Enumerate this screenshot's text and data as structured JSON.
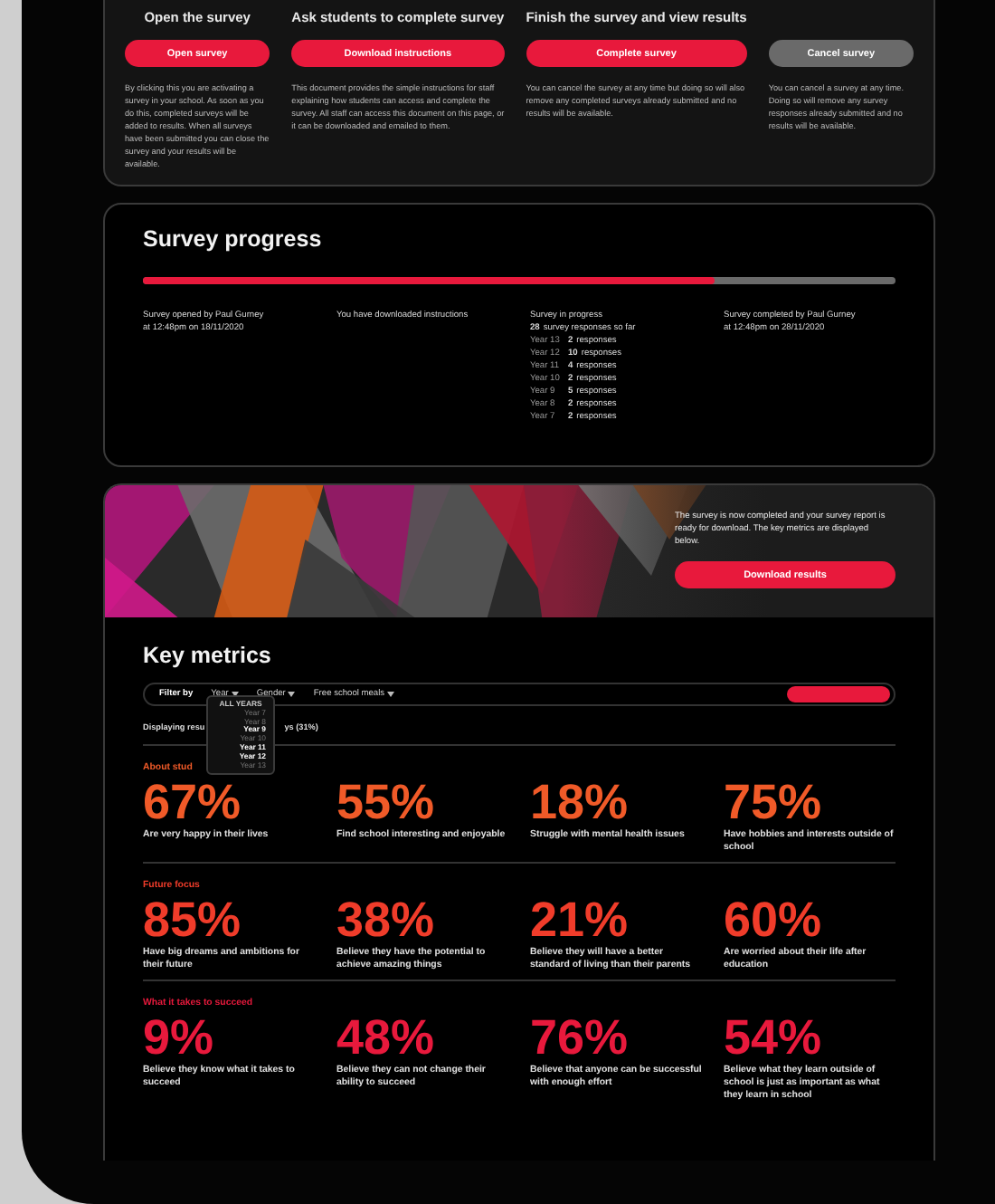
{
  "steps": [
    {
      "heading": "Open the survey",
      "button": "Open survey",
      "kind": "primary",
      "text": "By clicking this you are activating a survey in your school. As soon as you do this, completed surveys will be added to results. When all surveys have been submitted you can close the survey and your results will be available."
    },
    {
      "heading": "Ask students to complete survey",
      "button": "Download instructions",
      "kind": "primary",
      "text": "This document provides the simple instructions for staff explaining how students can access and complete the survey. All staff can access this document on this page, or it can be downloaded and emailed to them."
    },
    {
      "heading": "Finish the survey and view results",
      "button": "Complete survey",
      "kind": "primary",
      "text": "You can cancel the survey at any time but doing so will also remove any completed surveys already submitted and no results will be available."
    },
    {
      "button": "Cancel survey",
      "kind": "secondary",
      "text": "You can cancel a survey at any time. Doing so will remove any survey responses already submitted and no results will be available."
    }
  ],
  "progress": {
    "title": "Survey progress",
    "level": 0.76,
    "opened": [
      "Survey opened by Paul Gurney",
      "at 12:48pm on 18/11/2020"
    ],
    "downloaded": "You have downloaded instructions",
    "in_progress": {
      "title": "Survey in progress",
      "total": "28",
      "total_label": "survey responses so far",
      "rows": [
        {
          "year": "Year 13",
          "count": "2",
          "label": "responses"
        },
        {
          "year": "Year 12",
          "count": "10",
          "label": "responses"
        },
        {
          "year": "Year 11",
          "count": "4",
          "label": "responses"
        },
        {
          "year": "Year 10",
          "count": "2",
          "label": "responses"
        },
        {
          "year": "Year 9",
          "count": "5",
          "label": "responses"
        },
        {
          "year": "Year 8",
          "count": "2",
          "label": "responses"
        },
        {
          "year": "Year 7",
          "count": "2",
          "label": "responses"
        }
      ]
    },
    "completed": [
      "Survey completed by Paul Gurney",
      "at 12:48pm on 28/11/2020"
    ]
  },
  "banner": {
    "kind": "picture",
    "text": "The survey is now completed and your survey report is ready for download. The key metrics are displayed below.",
    "button": "Download results"
  },
  "key_metrics": {
    "title": "Key metrics",
    "filter_label": "Filter by",
    "filters": [
      "Year",
      "Gender",
      "Free school meals"
    ],
    "year_menu": [
      {
        "label": "ALL YEARS",
        "selected": false
      },
      {
        "label": "Year 7",
        "selected": false
      },
      {
        "label": "Year 8",
        "selected": false
      },
      {
        "label": "Year 9",
        "selected": true
      },
      {
        "label": "Year 10",
        "selected": false
      },
      {
        "label": "Year 11",
        "selected": true
      },
      {
        "label": "Year 12",
        "selected": true
      },
      {
        "label": "Year 13",
        "selected": false
      }
    ],
    "displaying": [
      "Displaying resu",
      "ys (31%)"
    ],
    "sections": [
      {
        "title": "About stud",
        "color": "#f05a28",
        "metrics": [
          {
            "value": "67%",
            "text": "Are very happy in their lives"
          },
          {
            "value": "55%",
            "text": "Find school interesting and enjoyable"
          },
          {
            "value": "18%",
            "text": "Struggle with mental health issues"
          },
          {
            "value": "75%",
            "text": "Have hobbies and interests outside of school"
          }
        ]
      },
      {
        "title": "Future focus",
        "color": "#f03c2a",
        "metrics": [
          {
            "value": "85%",
            "text": "Have big dreams and ambitions for their future"
          },
          {
            "value": "38%",
            "text": "Believe they have the potential to achieve amazing things"
          },
          {
            "value": "21%",
            "text": "Believe they will have a better standard of living than their parents"
          },
          {
            "value": "60%",
            "text": "Are worried about their life after education"
          }
        ]
      },
      {
        "title": "What it takes to succeed",
        "color": "#e8193c",
        "metrics": [
          {
            "value": "9%",
            "text": "Believe they know what it takes to succeed"
          },
          {
            "value": "48%",
            "text": "Believe they can not change their ability to succeed"
          },
          {
            "value": "76%",
            "text": "Believe that anyone can be successful with enough effort"
          },
          {
            "value": "54%",
            "text": "Believe what they learn outside of school is just as important as what they learn in school"
          }
        ]
      }
    ]
  }
}
